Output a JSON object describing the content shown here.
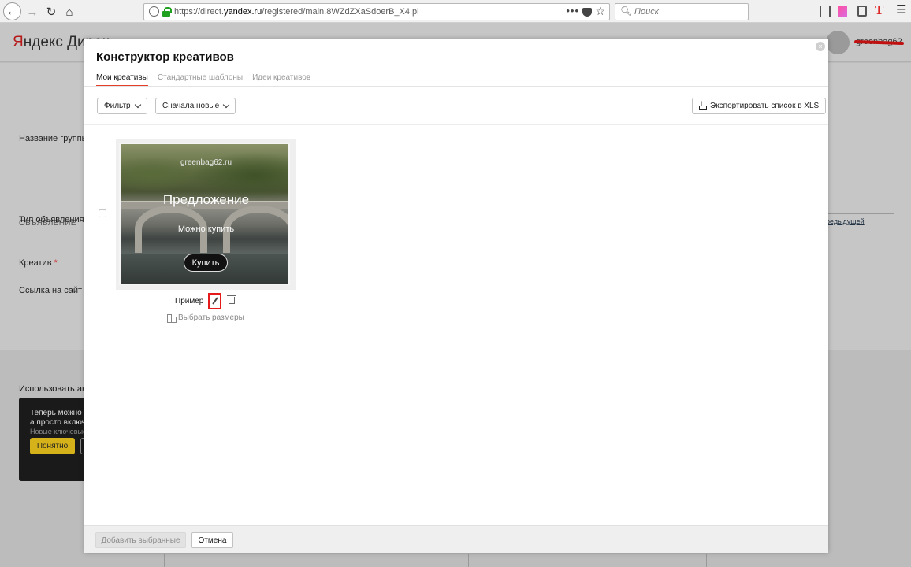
{
  "browser": {
    "url_prefix": "https://direct.",
    "url_domain": "yandex.ru",
    "url_path": "/registered/main.8WZdZXaSdoerB_X4.pl",
    "search_placeholder": "Поиск"
  },
  "page": {
    "brand_y": "Я",
    "brand_rest": "ндекс Дирек",
    "user": "greenbag62",
    "group_name_label": "Название группы",
    "section_ad": "ОБЪЯВЛЕНИЕ",
    "ad_type_label": "Тип объявления",
    "creative_label": "Креатив",
    "site_link_label": "Ссылка на сайт",
    "prev_link": "редыдущей",
    "auto_label": "Использовать авто",
    "tip_line1": "Теперь можно н",
    "tip_line2": "а просто включи",
    "tip_line3": "Новые ключевые с",
    "tip_ok": "Понятно",
    "required_mark": "*"
  },
  "modal": {
    "title": "Конструктор креативов",
    "tabs": [
      {
        "label": "Мои креативы",
        "active": true
      },
      {
        "label": "Стандартные шаблоны",
        "active": false
      },
      {
        "label": "Идеи креативов",
        "active": false
      }
    ],
    "filter_label": "Фильтр",
    "sort_label": "Сначала новые",
    "export_label": "Экспортировать список в XLS",
    "creative": {
      "site": "greenbag62.ru",
      "headline": "Предложение",
      "subtext": "Можно купить",
      "button": "Купить",
      "name": "Пример",
      "choose_sizes": "Выбрать размеры"
    },
    "add_selected": "Добавить выбранные",
    "cancel": "Отмена"
  },
  "colors": {
    "accent_tab": "#e53e2a",
    "highlight_box": "#e51b1b",
    "tip_button": "#d6b21a"
  }
}
